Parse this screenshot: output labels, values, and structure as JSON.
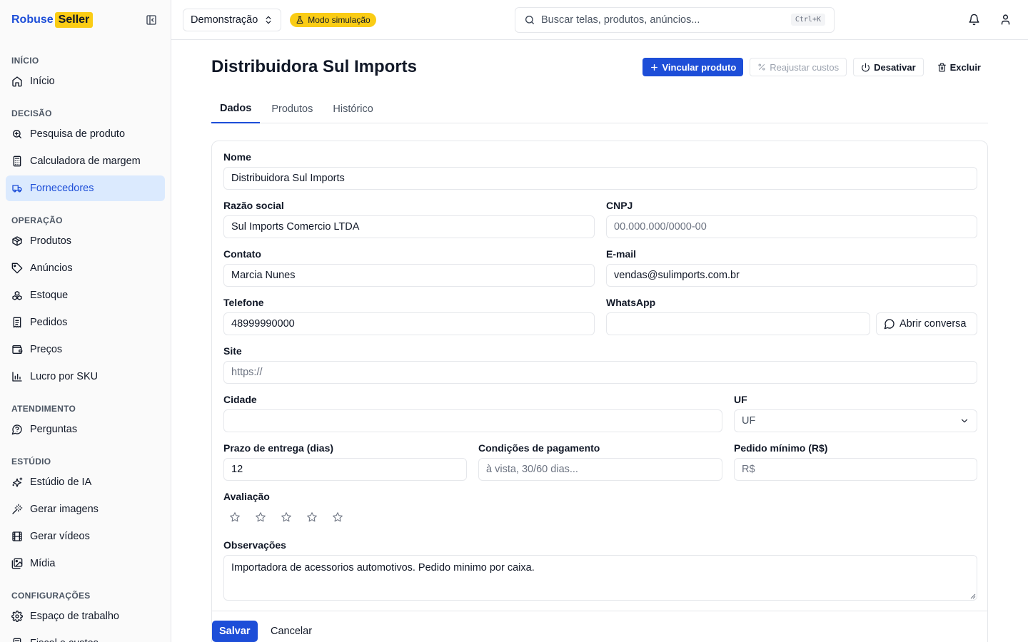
{
  "brand": {
    "part1": "Robuse",
    "part2": "Seller"
  },
  "sidebar": {
    "sections": [
      {
        "label": "INÍCIO",
        "items": [
          {
            "label": "Início",
            "icon": "home-icon",
            "active": false
          }
        ]
      },
      {
        "label": "DECISÃO",
        "items": [
          {
            "label": "Pesquisa de produto",
            "icon": "search-zoom-icon",
            "active": false
          },
          {
            "label": "Calculadora de margem",
            "icon": "calculator-icon",
            "active": false
          },
          {
            "label": "Fornecedores",
            "icon": "truck-icon",
            "active": true
          }
        ]
      },
      {
        "label": "OPERAÇÃO",
        "items": [
          {
            "label": "Produtos",
            "icon": "package-icon",
            "active": false
          },
          {
            "label": "Anúncios",
            "icon": "tag-icon",
            "active": false
          },
          {
            "label": "Estoque",
            "icon": "boxes-icon",
            "active": false
          },
          {
            "label": "Pedidos",
            "icon": "receipt-icon",
            "active": false
          },
          {
            "label": "Preços",
            "icon": "wallet-icon",
            "active": false
          },
          {
            "label": "Lucro por SKU",
            "icon": "bar-chart-icon",
            "active": false
          }
        ]
      },
      {
        "label": "ATENDIMENTO",
        "items": [
          {
            "label": "Perguntas",
            "icon": "question-bubble-icon",
            "active": false
          }
        ]
      },
      {
        "label": "ESTÚDIO",
        "items": [
          {
            "label": "Estúdio de IA",
            "icon": "sparkles-icon",
            "active": false
          },
          {
            "label": "Gerar imagens",
            "icon": "magic-wand-icon",
            "active": false
          },
          {
            "label": "Gerar vídeos",
            "icon": "film-icon",
            "active": false
          },
          {
            "label": "Mídia",
            "icon": "images-icon",
            "active": false
          }
        ]
      },
      {
        "label": "CONFIGURAÇÕES",
        "items": [
          {
            "label": "Espaço de trabalho",
            "icon": "gear-icon",
            "active": false
          },
          {
            "label": "Fiscal e custos",
            "icon": "calculator-icon",
            "active": false
          }
        ]
      }
    ]
  },
  "topbar": {
    "workspace": "Demonstração",
    "sim_badge": "Modo simulação",
    "search_placeholder": "Buscar telas, produtos, anúncios...",
    "search_shortcut": "Ctrl+K"
  },
  "page": {
    "title": "Distribuidora Sul Imports",
    "actions": {
      "link_product": "Vincular produto",
      "adjust_costs": "Reajustar custos",
      "deactivate": "Desativar",
      "delete": "Excluir"
    },
    "tabs": [
      {
        "label": "Dados",
        "active": true
      },
      {
        "label": "Produtos",
        "active": false
      },
      {
        "label": "Histórico",
        "active": false
      }
    ]
  },
  "form": {
    "nome": {
      "label": "Nome",
      "value": "Distribuidora Sul Imports"
    },
    "razao_social": {
      "label": "Razão social",
      "value": "Sul Imports Comercio LTDA"
    },
    "cnpj": {
      "label": "CNPJ",
      "placeholder": "00.000.000/0000-00"
    },
    "contato": {
      "label": "Contato",
      "value": "Marcia Nunes"
    },
    "email": {
      "label": "E-mail",
      "value": "vendas@sulimports.com.br"
    },
    "telefone": {
      "label": "Telefone",
      "value": "48999990000"
    },
    "whatsapp": {
      "label": "WhatsApp",
      "value": "",
      "open_chat": "Abrir conversa"
    },
    "site": {
      "label": "Site",
      "placeholder": "https://"
    },
    "cidade": {
      "label": "Cidade",
      "value": ""
    },
    "uf": {
      "label": "UF",
      "selected": "UF"
    },
    "prazo": {
      "label": "Prazo de entrega (dias)",
      "value": "12"
    },
    "condicoes": {
      "label": "Condições de pagamento",
      "placeholder": "à vista, 30/60 dias..."
    },
    "pedido_minimo": {
      "label": "Pedido mínimo (R$)",
      "placeholder": "R$"
    },
    "avaliacao": {
      "label": "Avaliação",
      "rating": 0,
      "max": 5
    },
    "observacoes": {
      "label": "Observações",
      "value": "Importadora de acessorios automotivos. Pedido minimo por caixa."
    },
    "save": "Salvar",
    "cancel": "Cancelar"
  }
}
